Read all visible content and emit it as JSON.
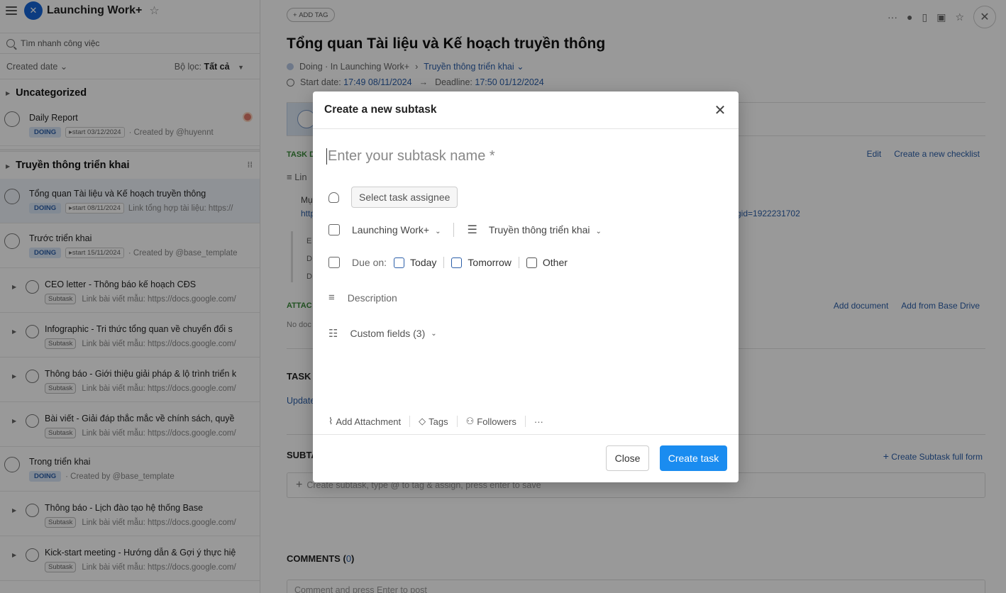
{
  "sidebar": {
    "title": "Launching Work+",
    "search_placeholder": "Tìm nhanh công việc",
    "sort_label": "Created date",
    "filter_label": "Bộ lọc:",
    "filter_value": "Tất cả",
    "group1": "Uncategorized",
    "group2": "Truyền thông triển khai",
    "tasks": [
      {
        "title": "Daily Report",
        "badge": "DOING",
        "start": "start 03/12/2024",
        "note": "· Created by @huyennt"
      },
      {
        "title": "Tổng quan Tài liệu và Kế hoạch truyền thông",
        "badge": "DOING",
        "start": "start 08/11/2024",
        "note": "Link tổng hợp tài liệu: https://"
      },
      {
        "title": "Trước triển khai",
        "badge": "DOING",
        "start": "start 15/11/2024",
        "note": "· Created by @base_template"
      },
      {
        "title": "CEO letter - Thông báo kế hoạch CĐS",
        "badge": "Subtask",
        "note": "Link bài viết mẫu: https://docs.google.com/"
      },
      {
        "title": "Infographic - Tri thức tổng quan về chuyển đổi s",
        "badge": "Subtask",
        "note": "Link bài viết mẫu: https://docs.google.com/"
      },
      {
        "title": "Thông báo - Giới thiệu giải pháp & lộ trình triển k",
        "badge": "Subtask",
        "note": "Link bài viết mẫu: https://docs.google.com/"
      },
      {
        "title": "Bài viết - Giải đáp thắc mắc về chính sách, quyề",
        "badge": "Subtask",
        "note": "Link bài viết mẫu: https://docs.google.com/"
      },
      {
        "title": "Trong triển khai",
        "badge": "DOING",
        "note": "· Created by @base_template"
      },
      {
        "title": "Thông báo - Lịch đào tạo hệ thống Base",
        "badge": "Subtask",
        "note": "Link bài viết mẫu: https://docs.google.com/"
      },
      {
        "title": "Kick-start meeting - Hướng dẫn & Gợi ý thực hiệ",
        "badge": "Subtask",
        "note": "Link bài viết mẫu: https://docs.google.com/"
      }
    ]
  },
  "main": {
    "add_tag": "ADD TAG",
    "title": "Tổng quan Tài liệu và Kế hoạch truyền thông",
    "status": "Doing · In Launching Work+",
    "breadcrumb_sep": "›",
    "project_link": "Truyền thông triển khai",
    "start_label": "Start date:",
    "start_value": "17:49 08/11/2024",
    "arrow": "→",
    "deadline_label": "Deadline:",
    "deadline_value": "17:50 01/12/2024",
    "task_desc_label": "TASK D",
    "lines_label": "Lin",
    "edit": "Edit",
    "create_checklist": "Create a new checklist",
    "mu": "Mụ",
    "http": "http",
    "gid": "gid=1922231702",
    "q1": "E",
    "q2": "D",
    "q3": "D",
    "attach_label": "ATTAC",
    "no_doc": "No doc",
    "add_document": "Add document",
    "add_from_drive": "Add from Base Drive",
    "task_label": "TASK",
    "update": "Update",
    "subtask_label": "SUBTA",
    "create_subtask_full": "Create Subtask full form",
    "subtask_placeholder": "Create subtask, type @ to tag & assign, press enter to save",
    "comments_label": "COMMENTS",
    "comments_open": "(",
    "comments_count": "0",
    "comments_close": ")",
    "comment_placeholder": "Comment and press Enter to post"
  },
  "modal": {
    "title": "Create a new subtask",
    "name_placeholder": "Enter your subtask name *",
    "assignee": "Select task assignee",
    "project": "Launching Work+",
    "list": "Truyền thông triển khai",
    "due_label": "Due on:",
    "today": "Today",
    "tomorrow": "Tomorrow",
    "other": "Other",
    "description": "Description",
    "custom_fields": "Custom fields (3)",
    "add_attachment": "Add Attachment",
    "tags": "Tags",
    "followers": "Followers",
    "more": "···",
    "close": "Close",
    "create": "Create task"
  }
}
